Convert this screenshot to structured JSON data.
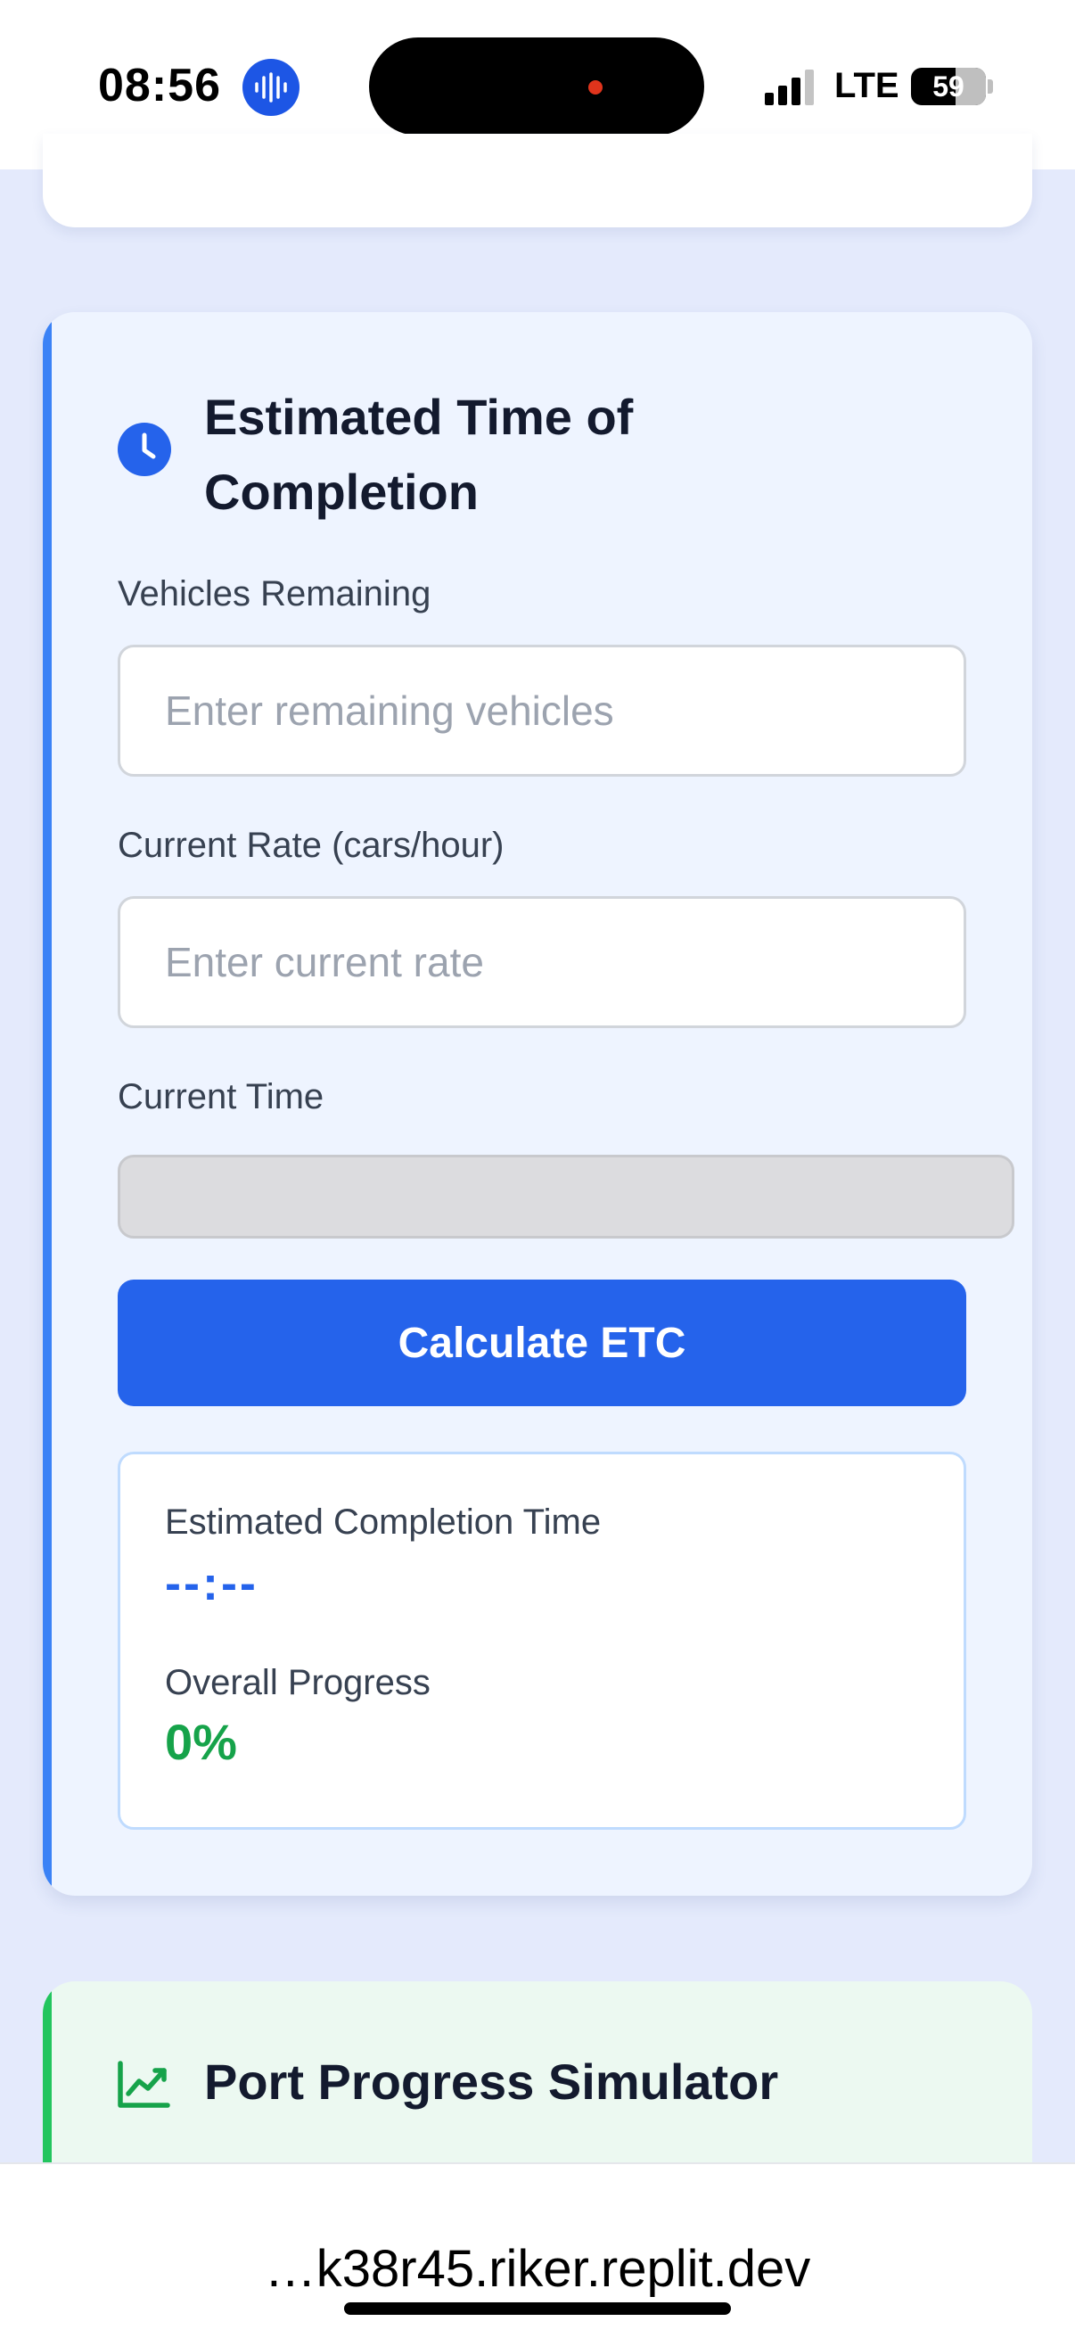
{
  "status_bar": {
    "time": "08:56",
    "network": "LTE",
    "battery": "59",
    "icons": [
      "voice-recording-icon",
      "signal-icon",
      "battery-icon"
    ]
  },
  "etc_card": {
    "icon": "clock-icon",
    "title": "Estimated Time of Completion",
    "vehicles_label": "Vehicles Remaining",
    "vehicles_placeholder": "Enter remaining vehicles",
    "vehicles_value": "",
    "rate_label": "Current Rate (cars/hour)",
    "rate_placeholder": "Enter current rate",
    "rate_value": "",
    "current_time_label": "Current Time",
    "current_time_value": "",
    "calculate_button": "Calculate ETC",
    "result": {
      "completion_label": "Estimated Completion Time",
      "completion_value": "--:--",
      "progress_label": "Overall Progress",
      "progress_value": "0%"
    },
    "accent_color": "#3b82f6",
    "button_color": "#2563eb",
    "progress_color": "#16a34a"
  },
  "simulator_card": {
    "icon": "chart-line-icon",
    "title": "Port Progress Simulator",
    "accent_color": "#22c55e"
  },
  "browser": {
    "url": "…k38r45.riker.replit.dev"
  }
}
